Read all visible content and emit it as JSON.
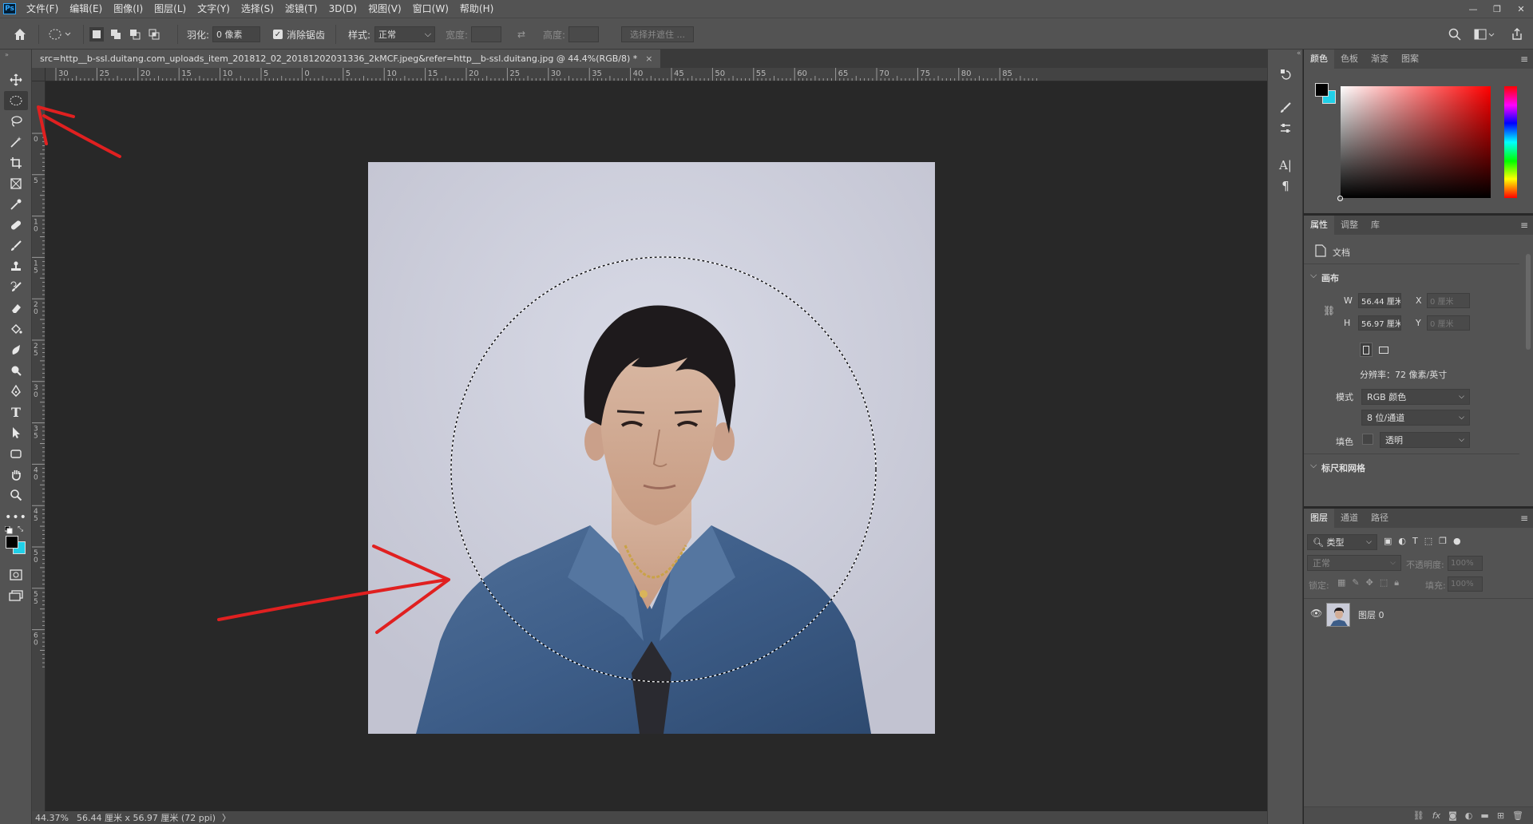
{
  "app": {
    "logo": "Ps"
  },
  "menu": [
    "文件(F)",
    "编辑(E)",
    "图像(I)",
    "图层(L)",
    "文字(Y)",
    "选择(S)",
    "滤镜(T)",
    "3D(D)",
    "视图(V)",
    "窗口(W)",
    "帮助(H)"
  ],
  "options": {
    "feather_label": "羽化:",
    "feather_value": "0 像素",
    "antialias_label": "消除锯齿",
    "style_label": "样式:",
    "style_value": "正常",
    "width_label": "宽度:",
    "height_label": "高度:",
    "select_mask_button": "选择并遮住 ..."
  },
  "document": {
    "tab_title": "src=http__b-ssl.duitang.com_uploads_item_201812_02_20181202031336_2kMCF.jpeg&refer=http__b-ssl.duitang.jpg @ 44.4%(RGB/8) *",
    "close": "×"
  },
  "rulers": {
    "h_labels": [
      "30",
      "25",
      "20",
      "15",
      "10",
      "5",
      "0",
      "5",
      "10",
      "15",
      "20",
      "25",
      "30",
      "35",
      "40",
      "45",
      "50",
      "55",
      "60",
      "65",
      "70",
      "75",
      "80",
      "85"
    ],
    "v_labels": [
      "0",
      "5",
      "1 0",
      "1 5",
      "2 0",
      "2 5",
      "3 0",
      "3 5",
      "4 0",
      "4 5",
      "5 0",
      "5 5",
      "6 0"
    ]
  },
  "status": {
    "zoom": "44.37%",
    "doc_size": "56.44 厘米 x 56.97 厘米 (72 ppi)",
    "arrow": "〉"
  },
  "color_panel": {
    "tabs": [
      "颜色",
      "色板",
      "渐变",
      "图案"
    ],
    "foreground": "#000000",
    "background": "#20d0e8",
    "hue": "#ff0000"
  },
  "properties_panel": {
    "tabs": [
      "属性",
      "调整",
      "库"
    ],
    "doc_label": "文档",
    "canvas_section": "画布",
    "w_label": "W",
    "w_value": "56.44 厘米",
    "x_label": "X",
    "x_value": "0 厘米",
    "h_label": "H",
    "h_value": "56.97 厘米",
    "y_label": "Y",
    "y_value": "0 厘米",
    "resolution": "分辨率：72 像素/英寸",
    "mode_label": "模式",
    "mode_value": "RGB 颜色",
    "depth_value": "8 位/通道",
    "fill_label": "填色",
    "fill_value": "透明",
    "rulers_section": "标尺和网格"
  },
  "layers_panel": {
    "tabs": [
      "图层",
      "通道",
      "路径"
    ],
    "filter_label": "类型",
    "blend_mode": "正常",
    "opacity_label": "不透明度:",
    "opacity_value": "100%",
    "lock_label": "锁定:",
    "fill_label": "填充:",
    "fill_value": "100%",
    "layer_name": "图层 0"
  },
  "colors": {
    "annotation_red": "#e02020",
    "ui_bg": "#535353"
  }
}
